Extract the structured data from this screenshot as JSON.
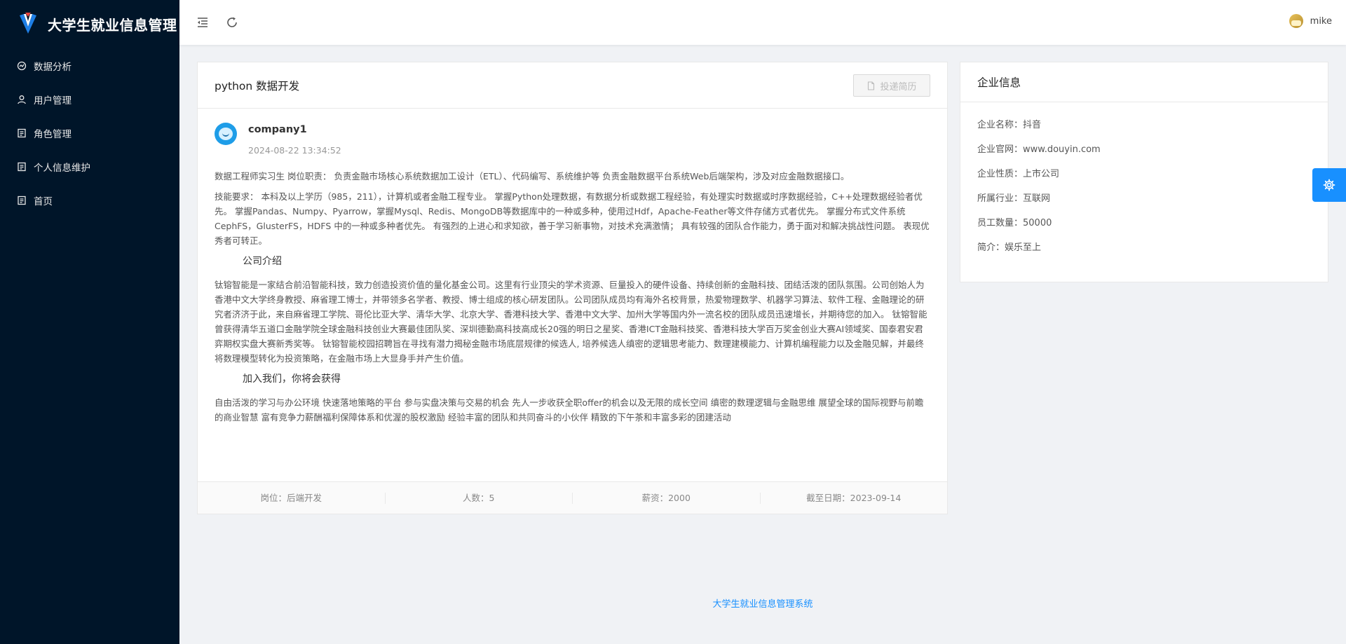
{
  "app": {
    "title": "大学生就业信息管理"
  },
  "sidebar": {
    "items": [
      {
        "label": "数据分析",
        "icon": "chart-icon"
      },
      {
        "label": "用户管理",
        "icon": "user-icon"
      },
      {
        "label": "角色管理",
        "icon": "document-icon"
      },
      {
        "label": "个人信息维护",
        "icon": "document-icon"
      },
      {
        "label": "首页",
        "icon": "document-icon"
      }
    ]
  },
  "header": {
    "username": "mike"
  },
  "job": {
    "title": "python 数据开发",
    "apply_label": "投递简历",
    "company_name": "company1",
    "publish_time": "2024-08-22 13:34:52",
    "paragraph1": "数据工程师实习生 岗位职责： 负责金融市场核心系统数据加工设计（ETL）、代码编写、系统维护等 负责金融数据平台系统Web后端架构，涉及对应金融数据接口。",
    "paragraph2": "技能要求： 本科及以上学历（985，211），计算机或者金融工程专业。 掌握Python处理数据，有数据分析或数据工程经验，有处理实时数据或时序数据经验，C++处理数据经验者优先。 掌握Pandas、Numpy、Pyarrow，掌握Mysql、Redis、MongoDB等数据库中的一种或多种，使用过Hdf，Apache-Feather等文件存储方式者优先。 掌握分布式文件系统CephFS，GlusterFS，HDFS 中的一种或多种者优先。 有强烈的上进心和求知欲，善于学习新事物，对技术充满激情； 具有较强的团队合作能力，勇于面对和解决挑战性问题。 表现优秀者可转正。",
    "heading1": "公司介绍",
    "paragraph3": "钛镕智能是一家结合前沿智能科技，致力创造投资价值的量化基金公司。这里有行业顶尖的学术资源、巨量投入的硬件设备、持续创新的金融科技、团结活泼的团队氛围。公司创始人为香港中文大学终身教授、麻省理工博士，并带领多名学者、教授、博士组成的核心研发团队。公司团队成员均有海外名校背景，热爱物理数学、机器学习算法、软件工程、金融理论的研究者济济于此，来自麻省理工学院、哥伦比亚大学、清华大学、北京大学、香港科技大学、香港中文大学、加州大学等国内外一流名校的团队成员迅速增长，并期待您的加入。 钛镕智能曾获得清华五道口金融学院全球金融科技创业大赛最佳团队奖、深圳德勤高科技高成长20强的明日之星奖、香港ICT金融科技奖、香港科技大学百万奖金创业大赛AI领域奖、国泰君安君弈期权实盘大赛新秀奖等。 钛镕智能校园招聘旨在寻找有潜力揭秘金融市场底层规律的候选人, 培养候选人缜密的逻辑思考能力、数理建模能力、计算机编程能力以及金融见解，并最终将数理模型转化为投资策略，在金融市场上大显身手并产生价值。",
    "heading2": "加入我们，你将会获得",
    "paragraph4": "自由活泼的学习与办公环境 快速落地策略的平台 参与实盘决策与交易的机会 先人一步收获全职offer的机会以及无限的成长空间 缜密的数理逻辑与金融思维 展望全球的国际视野与前瞻的商业智慧 富有竞争力薪酬福利保障体系和优渥的股权激励 经验丰富的团队和共同奋斗的小伙伴 精致的下午茶和丰富多彩的团建活动",
    "footer": {
      "position": "岗位：后端开发",
      "headcount": "人数：5",
      "salary": "薪资：2000",
      "deadline": "截至日期：2023-09-14"
    }
  },
  "company": {
    "card_title": "企业信息",
    "fields": [
      "企业名称：抖音",
      "企业官网：www.douyin.com",
      "企业性质：上市公司",
      "所属行业：互联网",
      "员工数量：50000",
      "简介：娱乐至上"
    ]
  },
  "footer": {
    "text": "大学生就业信息管理系统"
  },
  "colors": {
    "sidebar_bg": "#001529",
    "accent": "#1890ff"
  }
}
